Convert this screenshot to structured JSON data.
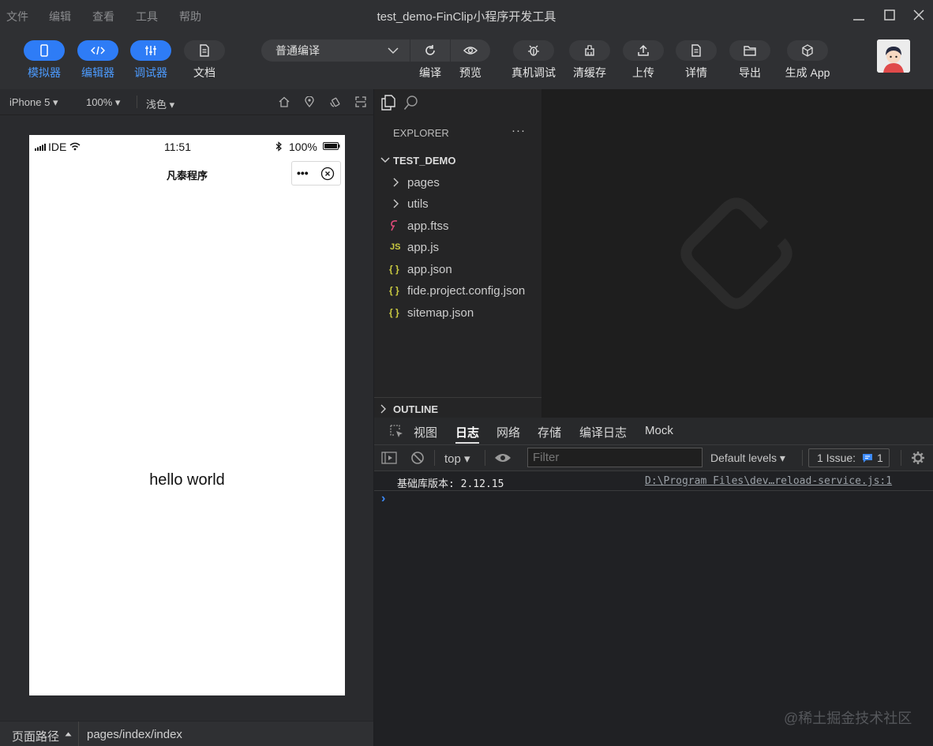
{
  "menu": [
    "文件",
    "编辑",
    "查看",
    "工具",
    "帮助"
  ],
  "window_title": "test_demo-FinClip小程序开发工具",
  "modes": [
    {
      "label": "模拟器",
      "active": true,
      "icon": "phone-icon"
    },
    {
      "label": "编辑器",
      "active": true,
      "icon": "code-icon"
    },
    {
      "label": "调试器",
      "active": true,
      "icon": "sliders-icon"
    },
    {
      "label": "文档",
      "active": false,
      "icon": "document-icon"
    }
  ],
  "compile": {
    "selected": "普通编译",
    "compile_label": "编译",
    "preview_label": "预览"
  },
  "tools": [
    "真机调试",
    "清缓存",
    "上传",
    "详情",
    "导出",
    "生成 App"
  ],
  "simulator": {
    "device": "iPhone 5",
    "zoom": "100%",
    "theme": "浅色",
    "status": {
      "carrier": "IDE",
      "time": "11:51",
      "battery": "100%"
    },
    "nav_title": "凡泰程序",
    "capsule_more": "•••",
    "content": "hello world"
  },
  "footer": {
    "path_label": "页面路径",
    "path_value": "pages/index/index"
  },
  "explorer": {
    "header": "EXPLORER",
    "more": "···",
    "project": "TEST_DEMO",
    "items": [
      {
        "label": "pages",
        "kind": "folder"
      },
      {
        "label": "utils",
        "kind": "folder"
      },
      {
        "label": "app.ftss",
        "kind": "style"
      },
      {
        "label": "app.js",
        "kind": "js",
        "badge": "JS"
      },
      {
        "label": "app.json",
        "kind": "json",
        "badge": "{ }"
      },
      {
        "label": "fide.project.config.json",
        "kind": "json",
        "badge": "{ }"
      },
      {
        "label": "sitemap.json",
        "kind": "json",
        "badge": "{ }"
      }
    ],
    "outline": "OUTLINE"
  },
  "devtools": {
    "tabs": [
      "视图",
      "日志",
      "网络",
      "存储",
      "编译日志",
      "Mock"
    ],
    "active_tab": "日志",
    "context": "top",
    "filter_placeholder": "Filter",
    "levels": "Default levels",
    "issues_label": "1 Issue:",
    "issues_count": "1",
    "log_message": "基础库版本: 2.12.15",
    "log_source": "D:\\Program Files\\dev…reload-service.js:1",
    "prompt": "›"
  },
  "watermark": "@稀土掘金技术社区",
  "colors": {
    "accent": "#2e7cf6",
    "panel": "#2f3033",
    "console_bg": "#202124"
  }
}
